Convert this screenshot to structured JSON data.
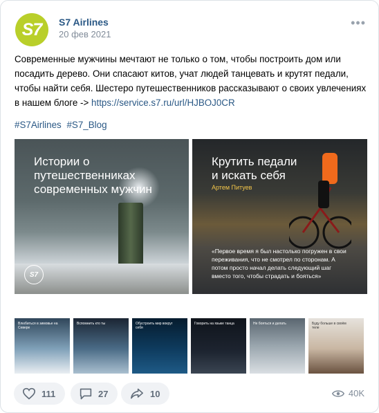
{
  "post": {
    "avatar_text": "S7",
    "author": "S7 Airlines",
    "date": "20 фев 2021",
    "more": "•••",
    "text": "Современные мужчины мечтают не только о том, чтобы построить дом или посадить дерево. Они спасают китов, учат людей танцевать и крутят педали, чтобы найти себя. Шестеро путешественников рассказывают о своих увлечениях в нашем блоге -> ",
    "link": "https://service.s7.ru/url/HJBOJ0CR",
    "tags": [
      "#S7Airlines",
      "#S7_Blog"
    ]
  },
  "images": {
    "main1": {
      "title_line1": "Истории о путешественниках",
      "title_line2": "современных мужчин",
      "logo": "S7"
    },
    "main2": {
      "title_line1": "Крутить педали",
      "title_line2": "и искать себя",
      "author": "Артем Питуев",
      "quote": "«Первое время я был настолько погружен в свои переживания, что не смотрел по сторонам. А потом просто начал делать следующий шаг вместо того, чтобы страдать и бояться»"
    }
  },
  "thumbnails": [
    {
      "title": "Влюбиться в зимовье на Севере",
      "bg": "#6e8fa8"
    },
    {
      "title": "Вспомнить кто ты",
      "bg": "#4a6b86"
    },
    {
      "title": "Обустроить мир вокруг себя",
      "bg": "#0e3b5e"
    },
    {
      "title": "Говорить на языке танца",
      "bg": "#1d2430"
    },
    {
      "title": "Не бояться и делать",
      "bg": "#7a8791"
    },
    {
      "title": "Буду больше в своём теле",
      "bg": "#c9b7a3"
    }
  ],
  "actions": {
    "likes": "111",
    "comments": "27",
    "shares": "10",
    "views": "40K"
  },
  "colors": {
    "brand": "#b9cf2a",
    "link": "#2a5885",
    "muted": "#818c99"
  }
}
